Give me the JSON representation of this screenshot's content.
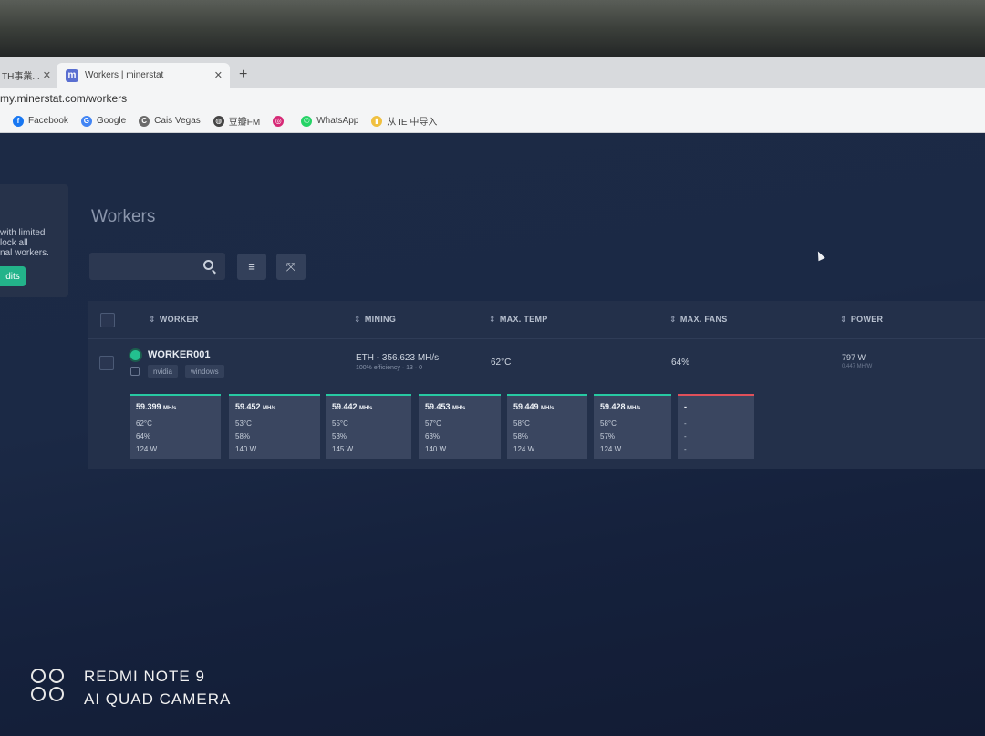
{
  "browser": {
    "tabs": [
      {
        "label": "TH事業..."
      },
      {
        "label": "Workers | minerstat"
      }
    ],
    "favicon_letter": "m",
    "new_tab": "+",
    "close_glyph": "✕",
    "url": "my.minerstat.com/workers",
    "bookmarks": [
      {
        "label": "Facebook",
        "icon": "facebook-icon",
        "color": "#1877f2",
        "glyph": "f"
      },
      {
        "label": "Google",
        "icon": "google-icon",
        "color": "#4285f4",
        "glyph": "G"
      },
      {
        "label": "Cais Vegas",
        "icon": "cais-vegas-icon",
        "color": "#6a6a6a",
        "glyph": "C"
      },
      {
        "label": "豆瓣FM",
        "icon": "globe-icon",
        "color": "#444444",
        "glyph": "◍"
      },
      {
        "label": "",
        "icon": "instagram-icon",
        "color": "#d62976",
        "glyph": "◎"
      },
      {
        "label": "WhatsApp",
        "icon": "whatsapp-icon",
        "color": "#25d366",
        "glyph": "✆"
      },
      {
        "label": "从 IE 中导入",
        "icon": "folder-icon",
        "color": "#f0c040",
        "glyph": "▮"
      }
    ]
  },
  "sidebar": {
    "promo_lines": [
      "with limited",
      "lock all",
      "nal workers."
    ],
    "credits_label": "dits"
  },
  "page": {
    "title": "Workers",
    "search_placeholder": ""
  },
  "table": {
    "headers": {
      "worker": "WORKER",
      "mining": "MINING",
      "max_temp": "MAX. TEMP",
      "max_fans": "MAX. FANS",
      "power": "POWER"
    },
    "worker": {
      "name": "WORKER001",
      "status_color": "#23c08f",
      "tags": [
        "nvidia",
        "windows"
      ],
      "mining": "ETH - 356.623 MH/s",
      "mining_sub": "100% efficiency · 13 · 0",
      "max_temp": "62°C",
      "max_fans": "64%",
      "power": "797 W",
      "power_sub": "0.447 MH/W"
    },
    "gpus": [
      {
        "hashrate": "59.399",
        "unit": "MH/s",
        "temp": "62°C",
        "fan": "64%",
        "power": "124 W",
        "status": "ok"
      },
      {
        "hashrate": "59.452",
        "unit": "MH/s",
        "temp": "53°C",
        "fan": "58%",
        "power": "140 W",
        "status": "ok"
      },
      {
        "hashrate": "59.442",
        "unit": "MH/s",
        "temp": "55°C",
        "fan": "53%",
        "power": "145 W",
        "status": "ok"
      },
      {
        "hashrate": "59.453",
        "unit": "MH/s",
        "temp": "57°C",
        "fan": "63%",
        "power": "140 W",
        "status": "ok"
      },
      {
        "hashrate": "59.449",
        "unit": "MH/s",
        "temp": "58°C",
        "fan": "58%",
        "power": "124 W",
        "status": "ok"
      },
      {
        "hashrate": "59.428",
        "unit": "MH/s",
        "temp": "58°C",
        "fan": "57%",
        "power": "124 W",
        "status": "ok"
      },
      {
        "hashrate": "-",
        "unit": "",
        "temp": "-",
        "fan": "-",
        "power": "-",
        "status": "offline"
      }
    ]
  },
  "watermark": {
    "line1": "REDMI NOTE 9",
    "line2": "AI QUAD CAMERA"
  }
}
